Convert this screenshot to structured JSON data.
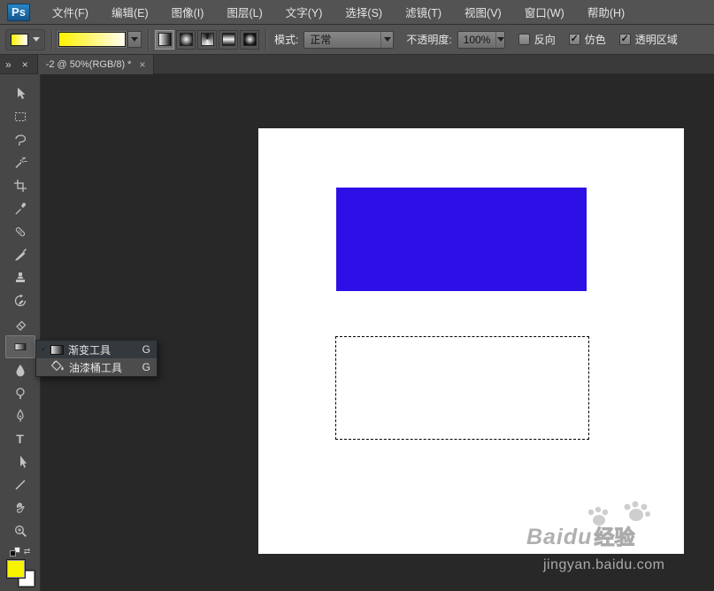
{
  "app": {
    "logo": "Ps"
  },
  "menu": {
    "items": [
      "文件(F)",
      "编辑(E)",
      "图像(I)",
      "图层(L)",
      "文字(Y)",
      "选择(S)",
      "滤镜(T)",
      "视图(V)",
      "窗口(W)",
      "帮助(H)"
    ]
  },
  "options": {
    "mode_label": "模式:",
    "mode_value": "正常",
    "opacity_label": "不透明度:",
    "opacity_value": "100%",
    "reverse_label": "反向",
    "reverse_checked": false,
    "dither_label": "仿色",
    "dither_checked": true,
    "transparency_label": "透明区域",
    "transparency_checked": true,
    "gradient_type_buttons": [
      "linear",
      "radial",
      "angle",
      "reflected",
      "diamond"
    ],
    "gradient_type_selected": "linear"
  },
  "tabbar": {
    "collapse_glyph": "»",
    "panel_close_glyph": "×",
    "tab_title": "-2 @ 50%(RGB/8) *",
    "tab_close_glyph": "×"
  },
  "toolbar": {
    "tools": [
      "move",
      "rectangular-marquee",
      "lasso",
      "quick-selection",
      "crop",
      "eyedropper",
      "spot-healing-brush",
      "brush",
      "clone-stamp",
      "history-brush",
      "eraser",
      "gradient",
      "blur",
      "dodge",
      "pen",
      "type",
      "path-selection",
      "line",
      "hand",
      "zoom"
    ],
    "selected_tool": "gradient",
    "type_tool_glyph": "T",
    "swap_glyph": "⇄",
    "foreground_color": "#f8f400",
    "background_color": "#ffffff"
  },
  "flyout": {
    "bullet_glyph": "▪",
    "items": [
      {
        "label": "渐变工具",
        "shortcut": "G",
        "selected": true
      },
      {
        "label": "油漆桶工具",
        "shortcut": "G",
        "selected": false
      }
    ]
  },
  "canvas": {
    "blue_rect_color": "#2c10e6",
    "watermark_brand": "Baidu",
    "watermark_suffix": "经验",
    "watermark_url": "jingyan.baidu.com"
  },
  "colors": {
    "gradient_start": "#fff200",
    "gradient_end": "#ffffff",
    "ui_background": "#535353",
    "canvas_background": "#282828"
  },
  "icons": {
    "check_glyph": "✓"
  }
}
